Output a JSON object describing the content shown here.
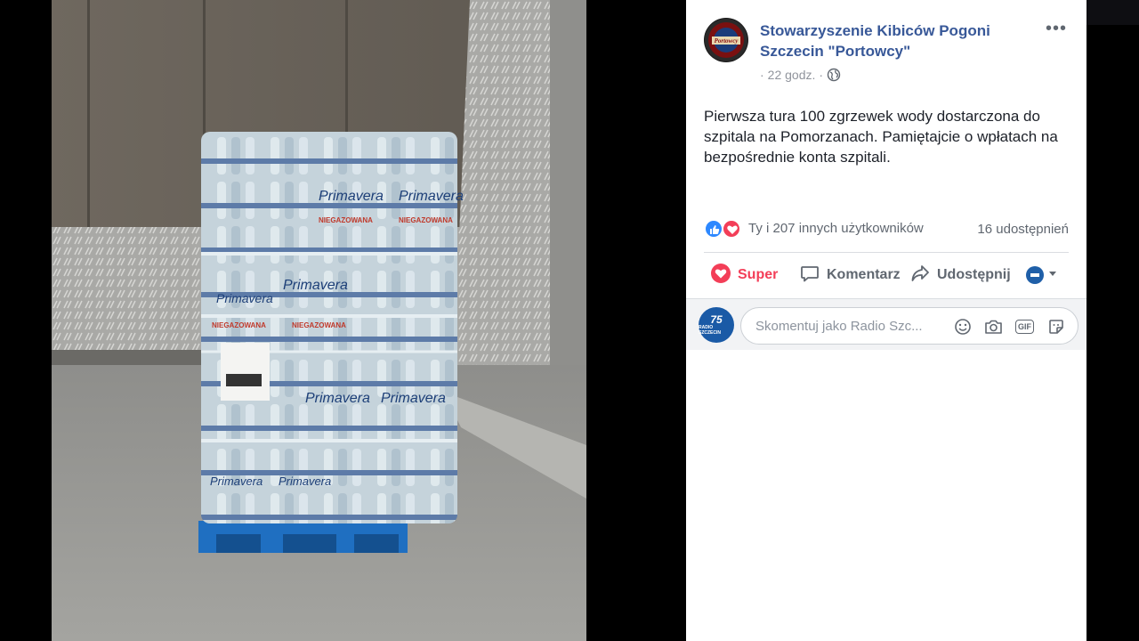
{
  "post": {
    "page_name": "Stowarzyszenie Kibiców Pogoni Szczecin \"Portowcy\"",
    "time": "22 godz.",
    "separator": "·",
    "text": "Pierwsza tura 100 zgrzewek wody dostarczona do szpitala na Pomorzanach. Pamiętajcie o wpłatach na bezpośrednie konta szpitali."
  },
  "avatar": {
    "logo_text": "Portowcy"
  },
  "reactions": {
    "summary": "Ty i 207 innych użytkowników",
    "shares": "16 udostępnień"
  },
  "actions": {
    "super": "Super",
    "comment": "Komentarz",
    "share": "Udostępnij"
  },
  "comment_box": {
    "placeholder": "Skomentuj jako Radio Szc...",
    "avatar_big": "75",
    "avatar_small": "RADIO SZCZECIN",
    "gif_label": "GIF"
  },
  "photo": {
    "brand": "Primavera",
    "label": "NIEGAZOWANA"
  },
  "colors": {
    "link": "#385898",
    "love": "#f33e58",
    "like": "#2d88ff"
  }
}
